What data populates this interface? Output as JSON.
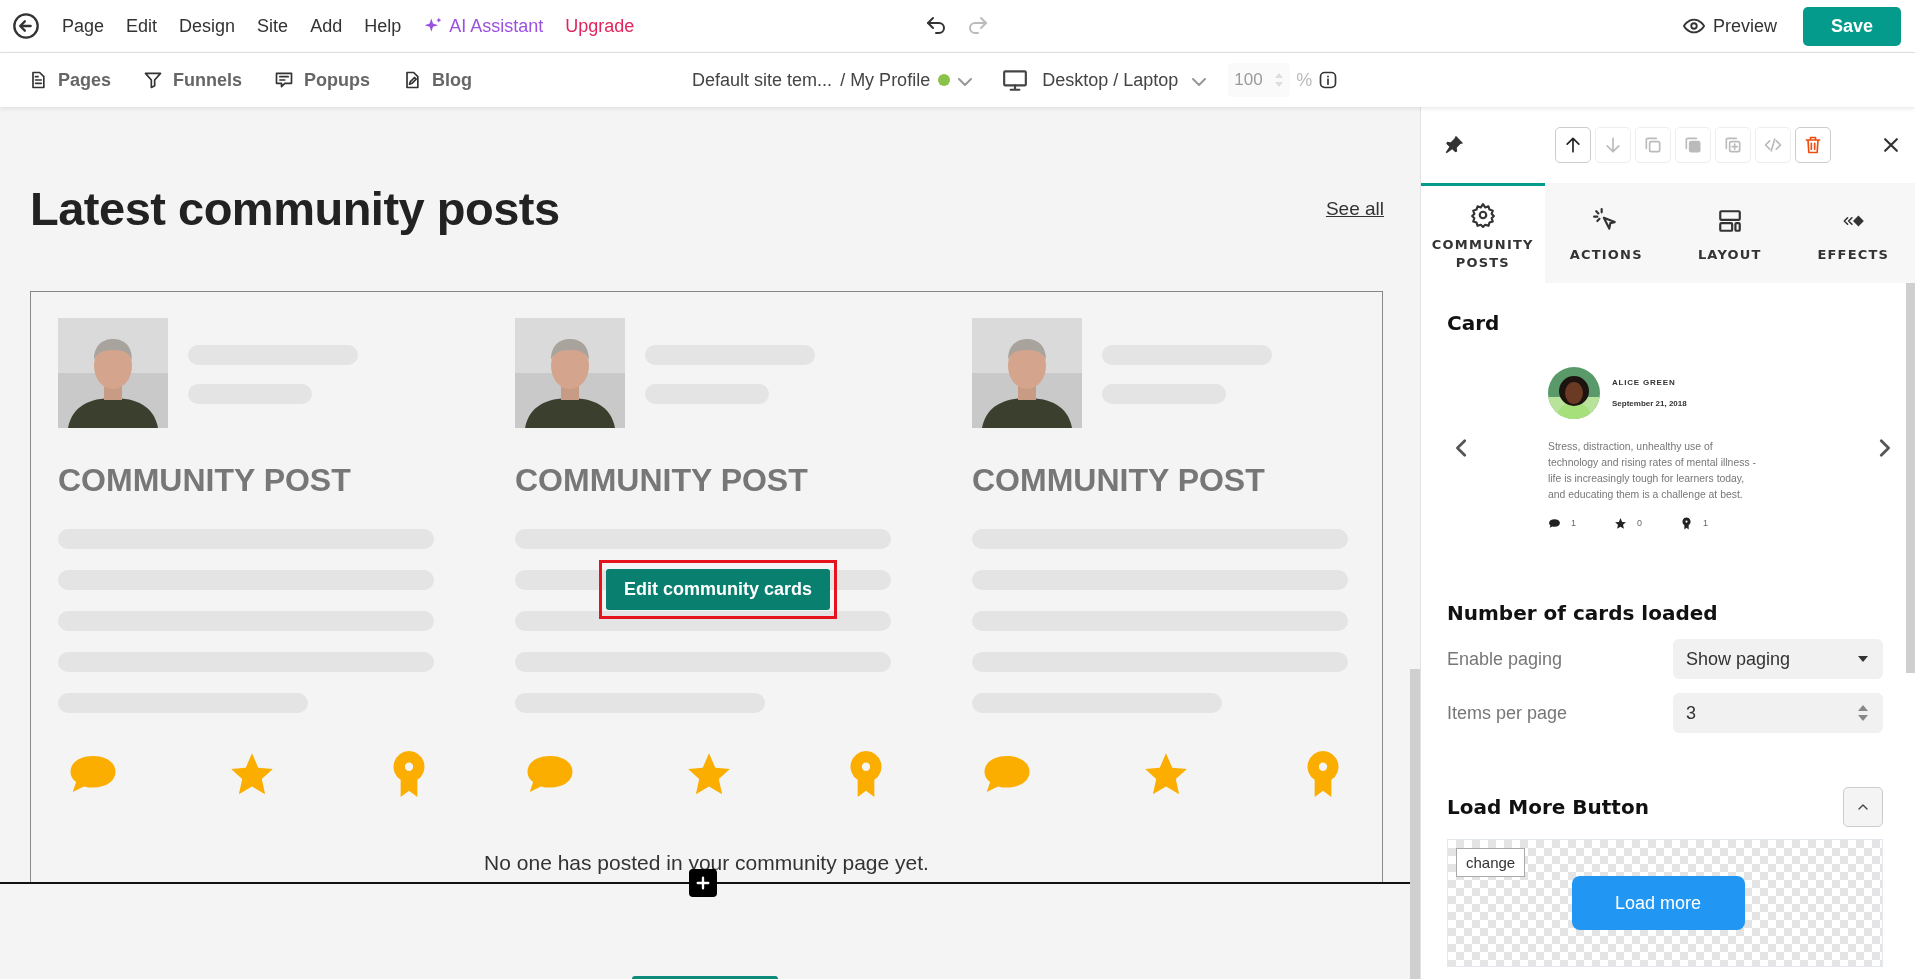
{
  "menu": [
    {
      "label": "Page"
    },
    {
      "label": "Edit"
    },
    {
      "label": "Design"
    },
    {
      "label": "Site"
    },
    {
      "label": "Add"
    },
    {
      "label": "Help"
    }
  ],
  "ai_assistant": "AI Assistant",
  "upgrade": "Upgrade",
  "preview": "Preview",
  "save": "Save",
  "nav": [
    {
      "label": "Pages",
      "kind": "pages"
    },
    {
      "label": "Funnels",
      "kind": "funnels"
    },
    {
      "label": "Popups",
      "kind": "popups"
    },
    {
      "label": "Blog",
      "kind": "blog"
    }
  ],
  "page_selector": {
    "template": "Default site tem...",
    "page": "/ My Profile",
    "published": true
  },
  "device": "Desktop / Laptop",
  "zoom": {
    "value": "100",
    "unit": "%",
    "disabled": true
  },
  "canvas": {
    "heading": "Latest community posts",
    "see_all": "See all",
    "cards": [
      {
        "title": "COMMUNITY POST"
      },
      {
        "title": "COMMUNITY POST"
      },
      {
        "title": "COMMUNITY POST"
      }
    ],
    "edit_button": "Edit community cards",
    "empty_message": "No one has posted in your community page yet."
  },
  "panel": {
    "toolbar": [
      {
        "kind": "up",
        "disabled": false
      },
      {
        "kind": "down",
        "disabled": true
      },
      {
        "kind": "copy",
        "disabled": true
      },
      {
        "kind": "layers",
        "disabled": true
      },
      {
        "kind": "add",
        "disabled": true
      },
      {
        "kind": "code",
        "disabled": true
      },
      {
        "kind": "delete",
        "disabled": false
      }
    ],
    "tabs": [
      {
        "label": "COMMUNITY POSTS",
        "kind": "settings",
        "selected": true
      },
      {
        "label": "ACTIONS",
        "kind": "actions",
        "selected": false
      },
      {
        "label": "LAYOUT",
        "kind": "layout",
        "selected": false
      },
      {
        "label": "EFFECTS",
        "kind": "effects",
        "selected": false
      }
    ],
    "card": {
      "title": "Card",
      "name": "ALICE GREEN",
      "date": "September 21, 2018",
      "body": "Stress, distraction, unhealthy use of technology and rising rates of mental illness - life is increasingly tough for learners today, and educating them is a challenge at best.",
      "stats": [
        {
          "kind": "comment",
          "count": "1"
        },
        {
          "kind": "star",
          "count": "0"
        },
        {
          "kind": "award",
          "count": "1"
        }
      ]
    },
    "paging": {
      "title": "Number of cards loaded",
      "fields": [
        {
          "label": "Enable paging",
          "kind": "select",
          "value": "Show paging"
        },
        {
          "label": "Items per page",
          "kind": "number",
          "value": "3"
        }
      ]
    },
    "load_more": {
      "title": "Load More Button",
      "expanded": true,
      "change": "change",
      "button": "Load more"
    }
  }
}
